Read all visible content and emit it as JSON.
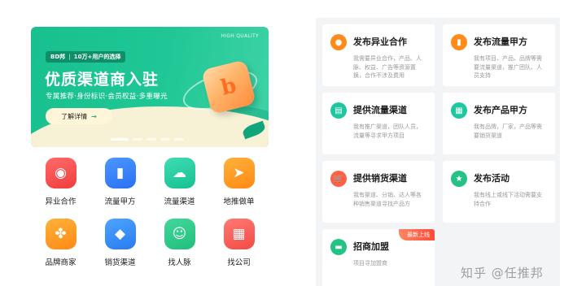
{
  "banner": {
    "quality_text": "HIGH QUALITY",
    "tag_left": "BD邦",
    "tag_right": "10万+用户的选择",
    "title": "优质渠道商入驻",
    "subtitle": "专属推荐·身份标识·会员权益·多重曝光",
    "button_label": "了解详情",
    "button_arrow": "→",
    "logo_glyph": "b",
    "carousel_count": 5
  },
  "grid_items": [
    {
      "label": "异业合作",
      "icon": "people-grid-icon",
      "glyph": "◉",
      "color": "#ef3d3d"
    },
    {
      "label": "流量甲方",
      "icon": "bar-chart-icon",
      "glyph": "▮",
      "color": "#2a6ff5"
    },
    {
      "label": "流量渠道",
      "icon": "cloud-icon",
      "glyph": "☁",
      "color": "#17c191"
    },
    {
      "label": "地推做单",
      "icon": "paper-plane-icon",
      "glyph": "➤",
      "color": "#ff8a14"
    },
    {
      "label": "品牌商家",
      "icon": "clover-icon",
      "glyph": "✤",
      "color": "#ff8a14"
    },
    {
      "label": "销货渠道",
      "icon": "cube-icon",
      "glyph": "◆",
      "color": "#287bf2"
    },
    {
      "label": "找人脉",
      "icon": "contacts-icon",
      "glyph": "☺",
      "color": "#1fbf7d"
    },
    {
      "label": "找公司",
      "icon": "building-icon",
      "glyph": "▦",
      "color": "#f24b45"
    }
  ],
  "cards": [
    {
      "title": "发布异业合作",
      "desc": "我需要异业合作，产品、人脉、权益、广告等资源置换，合作不涉及费用",
      "icon": "people-icon",
      "glyph": "●",
      "color": "#ff8b1a"
    },
    {
      "title": "发布流量甲方",
      "desc": "我有项目、产品、品牌等需要流量渠道，推广团队、人员支持",
      "icon": "chart-icon",
      "glyph": "▮",
      "color": "#ff8b1a"
    },
    {
      "title": "提供流量渠道",
      "desc": "我有推广渠道，团队人员，流量等寻求甲方项目",
      "icon": "document-icon",
      "glyph": "▤",
      "color": "#1ec7a0"
    },
    {
      "title": "发布产品甲方",
      "desc": "我有品牌，厂家，产品等需要销货渠道",
      "icon": "grid-icon",
      "glyph": "▦",
      "color": "#1ec7a0"
    },
    {
      "title": "提供销货渠道",
      "desc": "我有渠道、分销、达人等各种销售渠道寻找产品方",
      "icon": "cart-icon",
      "glyph": "🛒",
      "color": "#ff6244"
    },
    {
      "title": "发布活动",
      "desc": "我有线上或线下活动需要支持合作",
      "icon": "star-icon",
      "glyph": "★",
      "color": "#24c286"
    },
    {
      "title": "招商加盟",
      "desc": "项目寻加盟商",
      "icon": "store-icon",
      "glyph": "▬",
      "color": "#24c286",
      "badge": "最新上线"
    }
  ],
  "watermark": "知乎 @任推邦"
}
